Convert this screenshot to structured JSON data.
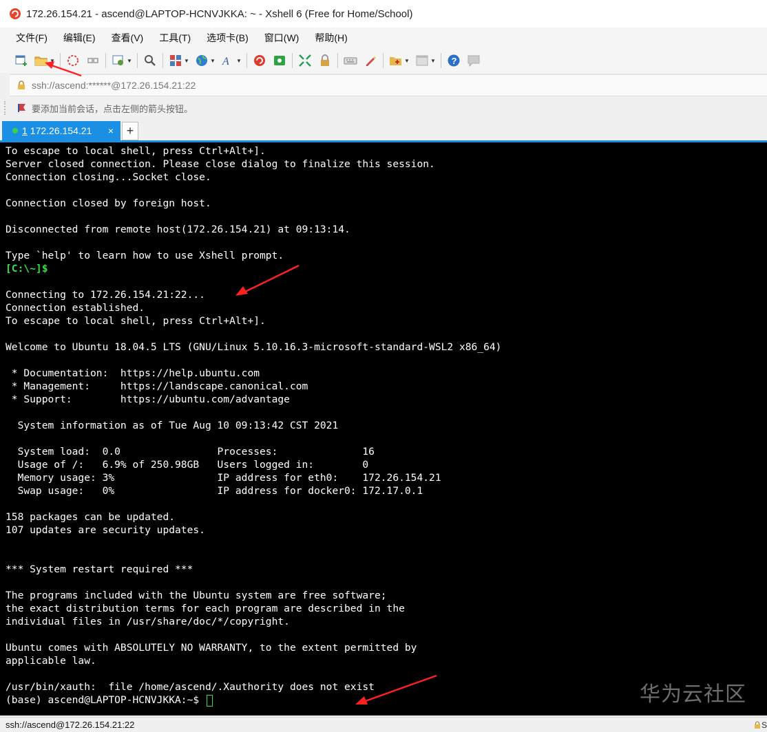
{
  "window": {
    "title": "172.26.154.21 - ascend@LAPTOP-HCNVJKKA: ~ - Xshell 6 (Free for Home/School)"
  },
  "menu": [
    "文件(F)",
    "编辑(E)",
    "查看(V)",
    "工具(T)",
    "选项卡(B)",
    "窗口(W)",
    "帮助(H)"
  ],
  "address": {
    "value": "ssh://ascend:******@172.26.154.21:22"
  },
  "hint": {
    "text": "要添加当前会话，点击左侧的箭头按钮。"
  },
  "tab": {
    "number": "1",
    "label": "172.26.154.21",
    "close": "×",
    "new": "+"
  },
  "terminal": {
    "lines": [
      {
        "text": "To escape to local shell, press Ctrl+Alt+]."
      },
      {
        "text": "Server closed connection. Please close dialog to finalize this session."
      },
      {
        "text": "Connection closing...Socket close."
      },
      {
        "text": ""
      },
      {
        "text": "Connection closed by foreign host."
      },
      {
        "text": ""
      },
      {
        "text": "Disconnected from remote host(172.26.154.21) at 09:13:14."
      },
      {
        "text": ""
      },
      {
        "text": "Type `help' to learn how to use Xshell prompt."
      },
      {
        "text": "[C:\\~]$",
        "color": "green"
      },
      {
        "text": ""
      },
      {
        "text": "Connecting to 172.26.154.21:22..."
      },
      {
        "text": "Connection established."
      },
      {
        "text": "To escape to local shell, press Ctrl+Alt+]."
      },
      {
        "text": ""
      },
      {
        "text": "Welcome to Ubuntu 18.04.5 LTS (GNU/Linux 5.10.16.3-microsoft-standard-WSL2 x86_64)"
      },
      {
        "text": ""
      },
      {
        "text": " * Documentation:  https://help.ubuntu.com"
      },
      {
        "text": " * Management:     https://landscape.canonical.com"
      },
      {
        "text": " * Support:        https://ubuntu.com/advantage"
      },
      {
        "text": ""
      },
      {
        "text": "  System information as of Tue Aug 10 09:13:42 CST 2021"
      },
      {
        "text": ""
      },
      {
        "text": "  System load:  0.0                Processes:              16"
      },
      {
        "text": "  Usage of /:   6.9% of 250.98GB   Users logged in:        0"
      },
      {
        "text": "  Memory usage: 3%                 IP address for eth0:    172.26.154.21"
      },
      {
        "text": "  Swap usage:   0%                 IP address for docker0: 172.17.0.1"
      },
      {
        "text": ""
      },
      {
        "text": "158 packages can be updated."
      },
      {
        "text": "107 updates are security updates."
      },
      {
        "text": ""
      },
      {
        "text": ""
      },
      {
        "text": "*** System restart required ***"
      },
      {
        "text": ""
      },
      {
        "text": "The programs included with the Ubuntu system are free software;"
      },
      {
        "text": "the exact distribution terms for each program are described in the"
      },
      {
        "text": "individual files in /usr/share/doc/*/copyright."
      },
      {
        "text": ""
      },
      {
        "text": "Ubuntu comes with ABSOLUTELY NO WARRANTY, to the extent permitted by"
      },
      {
        "text": "applicable law."
      },
      {
        "text": ""
      },
      {
        "text": "/usr/bin/xauth:  file /home/ascend/.Xauthority does not exist"
      }
    ],
    "prompt": "(base) ascend@LAPTOP-HCNVJKKA:~$ "
  },
  "watermark": "华为云社区",
  "status": {
    "text": "ssh://ascend@172.26.154.21:22",
    "right": "S"
  },
  "colors": {
    "accent": "#1a8fe3",
    "terminal_bg": "#000000",
    "prompt_green": "#35e04a",
    "annotation_arrow": "#ff2020"
  },
  "icons": [
    "new-session-icon",
    "open-folder-icon",
    "disconnect-icon",
    "reconnect-icon",
    "properties-icon",
    "find-icon",
    "color-scheme-icon",
    "globe-icon",
    "font-icon",
    "xftp-icon",
    "xmanager-icon",
    "fullscreen-icon",
    "lock-icon",
    "keyboard-icon",
    "highlight-icon",
    "add-tab-icon",
    "layout-icon",
    "help-icon",
    "chat-icon"
  ]
}
